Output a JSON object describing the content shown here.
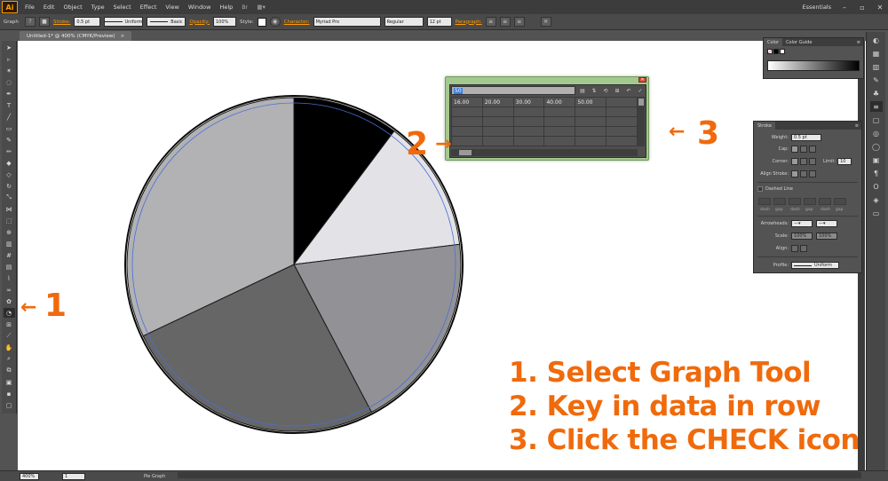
{
  "app": {
    "logo": "Ai",
    "menu": [
      "File",
      "Edit",
      "Object",
      "Type",
      "Select",
      "Effect",
      "View",
      "Window",
      "Help"
    ],
    "workspace": "Essentials",
    "window_controls": [
      "minimize-icon",
      "restore-icon",
      "close-icon"
    ]
  },
  "controlbar": {
    "selection": "Graph",
    "stroke_label": "Stroke:",
    "stroke_weight": "0.5 pt",
    "profile": "Uniform",
    "brush": "Basic",
    "opacity_label": "Opacity:",
    "opacity": "100%",
    "style_label": "Style:",
    "character_label": "Character:",
    "font": "Myriad Pro",
    "font_style": "Regular",
    "font_size": "12 pt",
    "paragraph_label": "Paragraph:"
  },
  "document": {
    "tab_title": "Untitled-1* @ 400% (CMYK/Preview)",
    "close": "×"
  },
  "graph_data": {
    "entry_value": "50",
    "row1": [
      "16.00",
      "20.00",
      "30.00",
      "40.00",
      "50.00",
      ""
    ],
    "buttons": [
      "import-data-icon",
      "transpose-icon",
      "switch-xy-icon",
      "cell-style-icon",
      "revert-icon",
      "apply-check-icon"
    ]
  },
  "chart_data": {
    "type": "pie",
    "values": [
      16,
      20,
      30,
      40,
      50
    ],
    "colors": [
      "#000000",
      "#e3e3e7",
      "#929296",
      "#666666",
      "#b2b2b4"
    ]
  },
  "annotations": {
    "num1": "1",
    "num2": "2",
    "num3": "3",
    "arrow": "←",
    "line1": "1. Select Graph Tool",
    "line2": "2. Key in data in row",
    "line3": "3. Click the CHECK icon"
  },
  "color_panel": {
    "tabs": [
      "Color",
      "Color Guide"
    ],
    "menu": "≡"
  },
  "stroke_panel": {
    "title": "Stroke",
    "weight_label": "Weight:",
    "weight": "0.5 pt",
    "cap_label": "Cap:",
    "corner_label": "Corner:",
    "limit_label": "Limit:",
    "limit": "10",
    "align_label": "Align Stroke:",
    "dashed_label": "Dashed Line",
    "dash_labels": [
      "dash",
      "gap",
      "dash",
      "gap",
      "dash",
      "gap"
    ],
    "arrowheads_label": "Arrowheads:",
    "scale_label": "Scale:",
    "scale1": "100%",
    "scale2": "100%",
    "align_label2": "Align:",
    "profile_label": "Profile:",
    "profile": "Uniform"
  },
  "statusbar": {
    "zoom": "400%",
    "artboard": "1",
    "tool_name": "Pie Graph"
  }
}
